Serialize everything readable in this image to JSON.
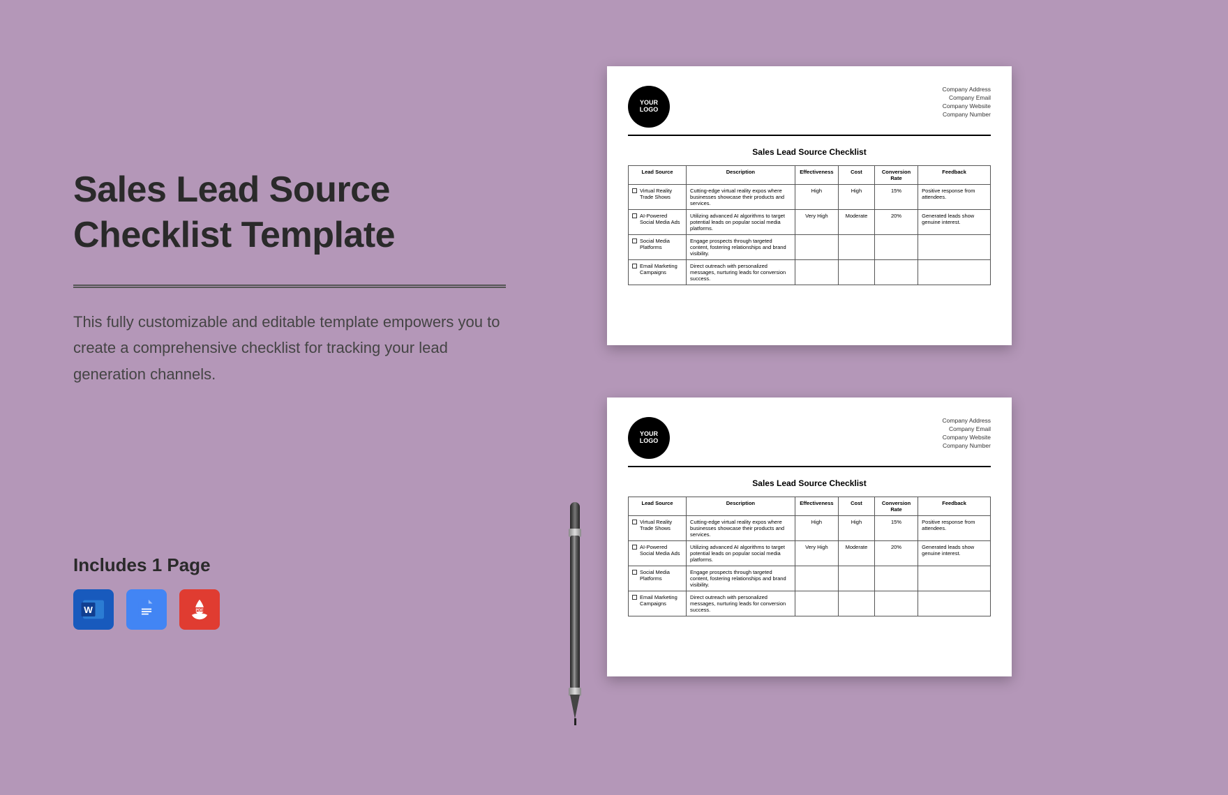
{
  "left": {
    "title": "Sales Lead Source Checklist Template",
    "description": "This fully customizable and editable template empowers you to create a comprehensive checklist for tracking your lead generation channels.",
    "includes": "Includes 1 Page"
  },
  "icons": {
    "word": "word-icon",
    "gdocs": "gdocs-icon",
    "pdf": "pdf-icon"
  },
  "doc": {
    "logo_text": "YOUR\nLOGO",
    "company_lines": [
      "Company Address",
      "Company Email",
      "Company Website",
      "Company Number"
    ],
    "title": "Sales Lead Source Checklist",
    "headers": [
      "Lead Source",
      "Description",
      "Effectiveness",
      "Cost",
      "Conversion Rate",
      "Feedback"
    ],
    "rows": [
      {
        "source": "Virtual Reality Trade Shows",
        "description": "Cutting-edge virtual reality expos where businesses showcase their products and services.",
        "effectiveness": "High",
        "cost": "High",
        "conversion": "15%",
        "feedback": "Positive response from attendees."
      },
      {
        "source": "AI-Powered Social Media Ads",
        "description": "Utilizing advanced AI algorithms to target potential leads on popular social media platforms.",
        "effectiveness": "Very High",
        "cost": "Moderate",
        "conversion": "20%",
        "feedback": "Generated leads show genuine interest."
      },
      {
        "source": "Social Media Platforms",
        "description": "Engage prospects through targeted content, fostering relationships and brand visibility.",
        "effectiveness": "",
        "cost": "",
        "conversion": "",
        "feedback": ""
      },
      {
        "source": "Email Marketing Campaigns",
        "description": "Direct outreach with personalized messages, nurturing leads for conversion success.",
        "effectiveness": "",
        "cost": "",
        "conversion": "",
        "feedback": ""
      }
    ]
  }
}
